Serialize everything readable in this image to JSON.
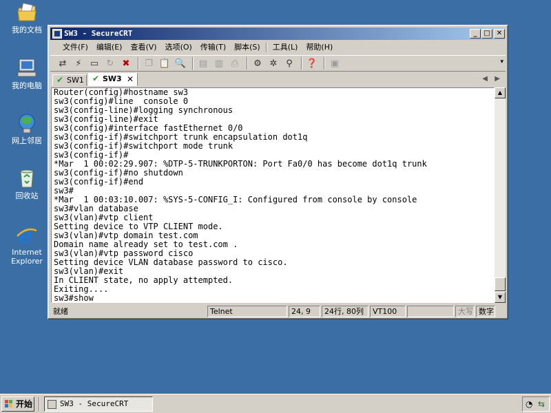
{
  "desktop": {
    "icons": [
      {
        "label": "我的文档",
        "icon": "folder-document-icon"
      },
      {
        "label": "我的电脑",
        "icon": "computer-icon"
      },
      {
        "label": "网上邻居",
        "icon": "network-icon"
      },
      {
        "label": "回收站",
        "icon": "recycle-bin-icon"
      },
      {
        "label": "Internet Explorer",
        "icon": "internet-explorer-icon"
      }
    ]
  },
  "window": {
    "title": "SW3 - SecureCRT",
    "menu": [
      "文件(F)",
      "编辑(E)",
      "查看(V)",
      "选项(O)",
      "传输(T)",
      "脚本(S)",
      "工具(L)",
      "帮助(H)"
    ],
    "tabs": [
      {
        "label": "SW1",
        "active": false
      },
      {
        "label": "SW3",
        "active": true
      }
    ],
    "terminal_lines": [
      "Router(config)#hostname sw3",
      "sw3(config)#line  console 0",
      "sw3(config-line)#logging synchronous",
      "sw3(config-line)#exit",
      "sw3(config)#interface fastEthernet 0/0",
      "sw3(config-if)#switchport trunk encapsulation dot1q",
      "sw3(config-if)#switchport mode trunk",
      "sw3(config-if)#",
      "*Mar  1 00:02:29.907: %DTP-5-TRUNKPORTON: Port Fa0/0 has become dot1q trunk",
      "sw3(config-if)#no shutdown",
      "sw3(config-if)#end",
      "sw3#",
      "*Mar  1 00:03:10.007: %SYS-5-CONFIG_I: Configured from console by console",
      "sw3#vlan database",
      "sw3(vlan)#vtp client",
      "Setting device to VTP CLIENT mode.",
      "sw3(vlan)#vtp domain test.com",
      "Domain name already set to test.com .",
      "sw3(vlan)#vtp password cisco",
      "Setting device VLAN database password to cisco.",
      "sw3(vlan)#exit",
      "In CLIENT state, no apply attempted.",
      "Exiting....",
      "sw3#show"
    ],
    "status": {
      "ready": "就绪",
      "protocol": "Telnet",
      "cursor": "24,  9",
      "size": "24行, 80列",
      "emulation": "VT100",
      "caps": "大写",
      "num": "数字"
    }
  },
  "taskbar": {
    "start_label": "开始",
    "task_label": "SW3 - SecureCRT"
  }
}
